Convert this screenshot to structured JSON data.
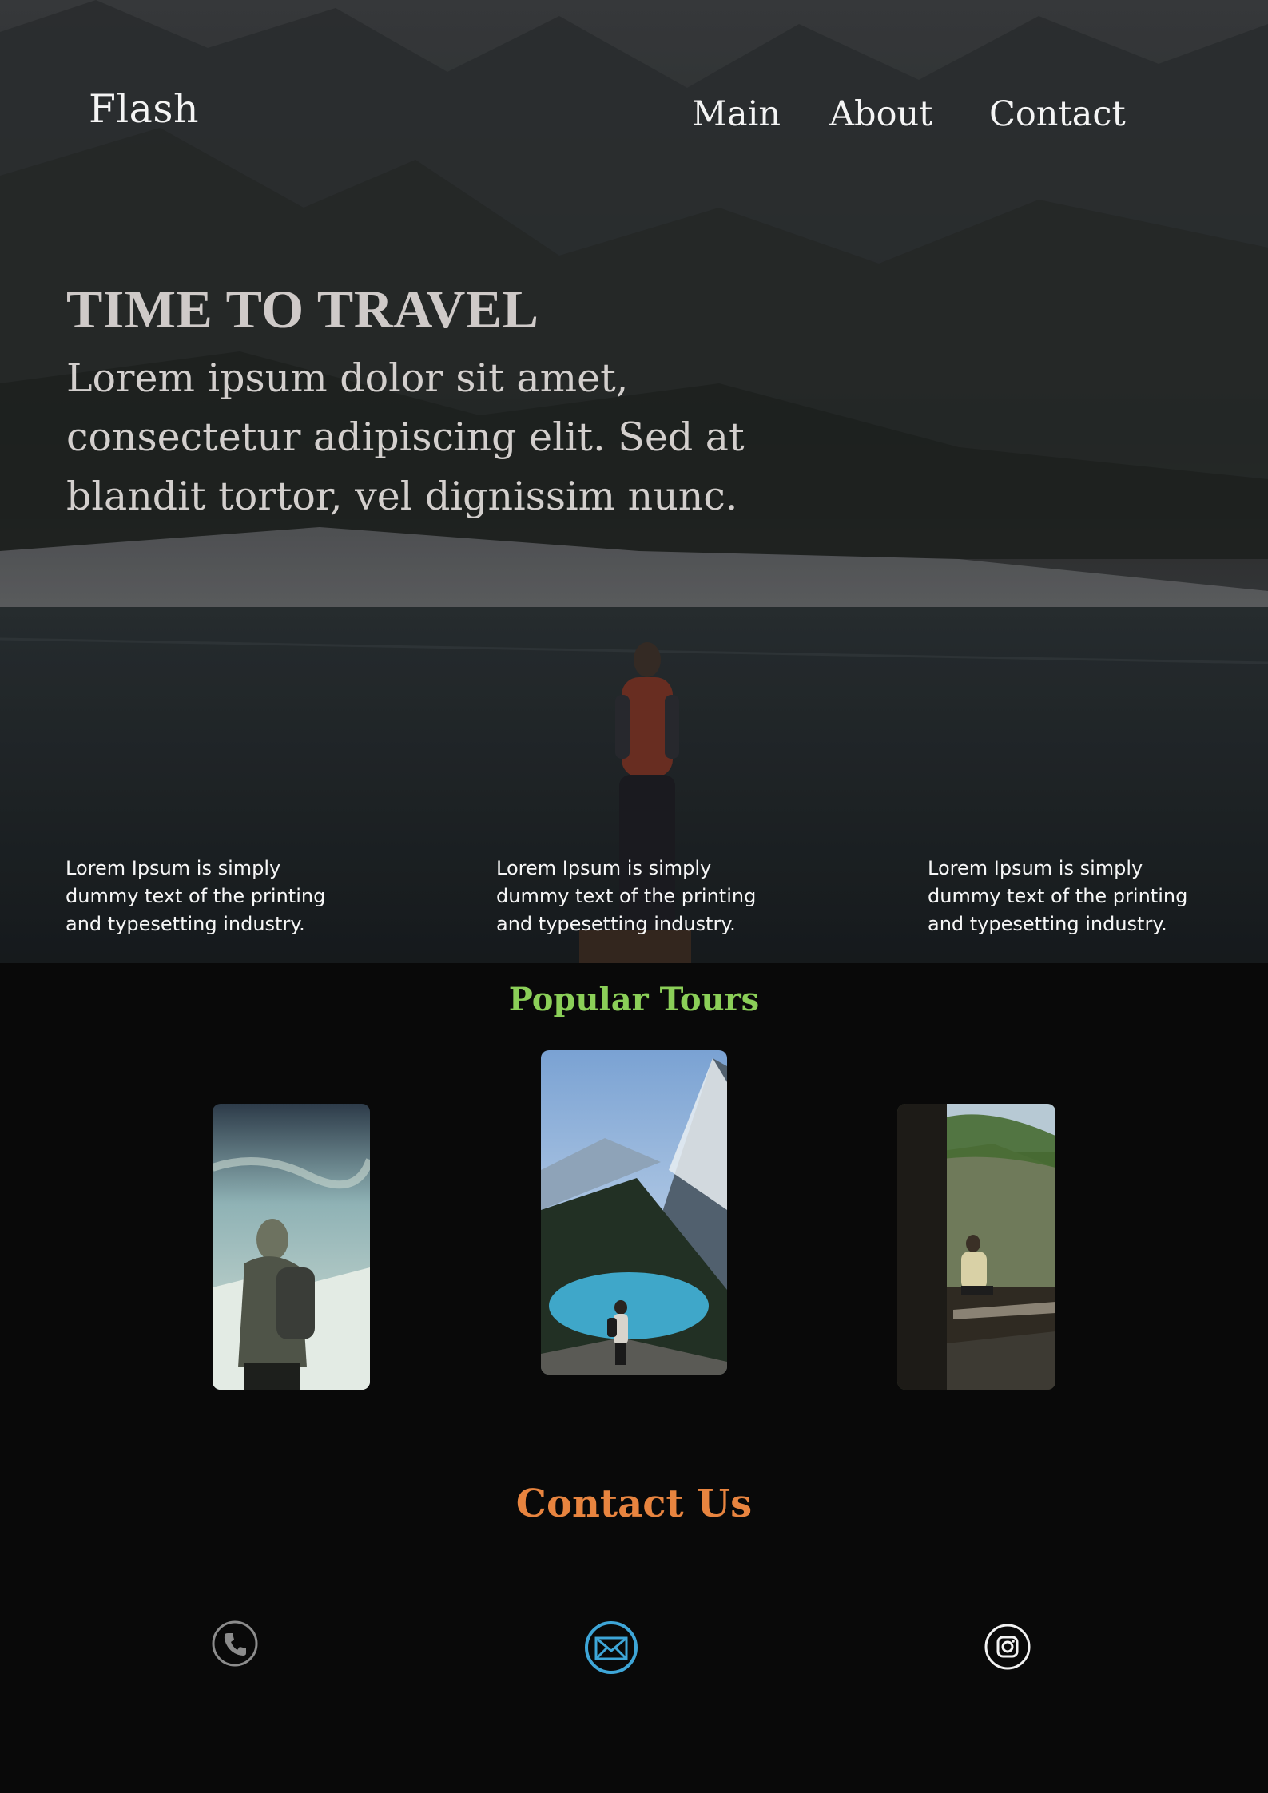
{
  "header": {
    "logo": "Flash",
    "nav": [
      "Main",
      "About",
      "Contact"
    ]
  },
  "hero": {
    "title": "TIME TO TRAVEL",
    "subtitle": "Lorem ipsum dolor sit amet, consectetur adipiscing elit. Sed at blandit tortor, vel dignissim nunc.",
    "features": [
      "Lorem Ipsum is simply dummy text of the printing and typesetting industry.",
      "Lorem Ipsum is simply dummy text of the printing and typesetting industry.",
      "Lorem Ipsum is simply dummy text of the printing and typesetting industry."
    ]
  },
  "tours": {
    "title": "Popular Tours"
  },
  "contact": {
    "title": "Contact Us",
    "icons": [
      "phone-icon",
      "mail-icon",
      "instagram-icon"
    ]
  },
  "colors": {
    "background": "#090909",
    "tours_title": "#8bcf58",
    "contact_title": "#e8843f",
    "mail_icon": "#3ea6d8"
  }
}
